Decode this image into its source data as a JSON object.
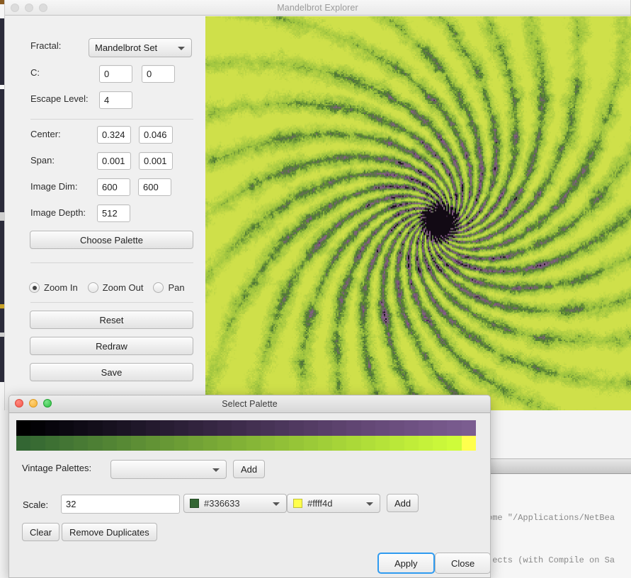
{
  "main_window": {
    "title": "Mandelbrot Explorer",
    "active": false,
    "controls": {
      "fractal_label": "Fractal:",
      "fractal_value": "Mandelbrot Set",
      "c_label": "C:",
      "c_real": "0",
      "c_imag": "0",
      "escape_label": "Escape Level:",
      "escape_value": "4",
      "center_label": "Center:",
      "center_x": "0.324",
      "center_y": "0.046",
      "span_label": "Span:",
      "span_x": "0.001",
      "span_y": "0.001",
      "image_dim_label": "Image Dim:",
      "image_dim_w": "600",
      "image_dim_h": "600",
      "image_depth_label": "Image Depth:",
      "image_depth_value": "512",
      "choose_palette_label": "Choose Palette",
      "modes": [
        {
          "label": "Zoom In",
          "selected": true
        },
        {
          "label": "Zoom Out",
          "selected": false
        },
        {
          "label": "Pan",
          "selected": false
        }
      ],
      "reset_label": "Reset",
      "redraw_label": "Redraw",
      "save_label": "Save"
    }
  },
  "palette_dialog": {
    "title": "Select Palette",
    "active": true,
    "vintage_label": "Vintage Palettes:",
    "vintage_value": "",
    "vintage_add_label": "Add",
    "scale_label": "Scale:",
    "scale_value": "32",
    "start_color": "#336633",
    "end_color": "#ffff4d",
    "color_add_label": "Add",
    "clear_label": "Clear",
    "remove_duplicates_label": "Remove Duplicates",
    "apply_label": "Apply",
    "close_label": "Close",
    "gradient_top": [
      "#000000",
      "#030206",
      "#07050c",
      "#0b0811",
      "#0f0b16",
      "#130e1a",
      "#17111f",
      "#1b1424",
      "#1f1729",
      "#241a2e",
      "#281d33",
      "#2c2038",
      "#31233d",
      "#352642",
      "#3a2947",
      "#3e2c4c",
      "#433051",
      "#473356",
      "#4b365b",
      "#503960",
      "#543c64",
      "#583f69",
      "#5c426d",
      "#604572",
      "#644876",
      "#674b7a",
      "#6b4e7e",
      "#6e5182",
      "#725486",
      "#755789",
      "#785a8d",
      "#7b5d90"
    ],
    "gradient_bottom": [
      "#336633",
      "#386b33",
      "#3d7033",
      "#437534",
      "#487a34",
      "#4d7f34",
      "#528434",
      "#578934",
      "#5d8e35",
      "#629335",
      "#679835",
      "#6c9d35",
      "#72a236",
      "#77a736",
      "#7cac36",
      "#81b136",
      "#86b637",
      "#8cbb37",
      "#91c037",
      "#96c537",
      "#9bca38",
      "#a0cf38",
      "#a6d438",
      "#abd938",
      "#b0de39",
      "#b5e339",
      "#bae839",
      "#c0ed39",
      "#c5f23a",
      "#caf73a",
      "#cffc3a",
      "#ffff4d"
    ]
  },
  "background": {
    "console_line1": "ome \"/Applications/NetBea",
    "console_line2": "jects (with Compile on Sa"
  },
  "fractal": {
    "palette_green_light": "#cfe04a",
    "palette_green": "#9ec43f",
    "palette_green_dark": "#4e7a32",
    "palette_purple": "#8a5a8e",
    "palette_dark": "#120a14"
  }
}
